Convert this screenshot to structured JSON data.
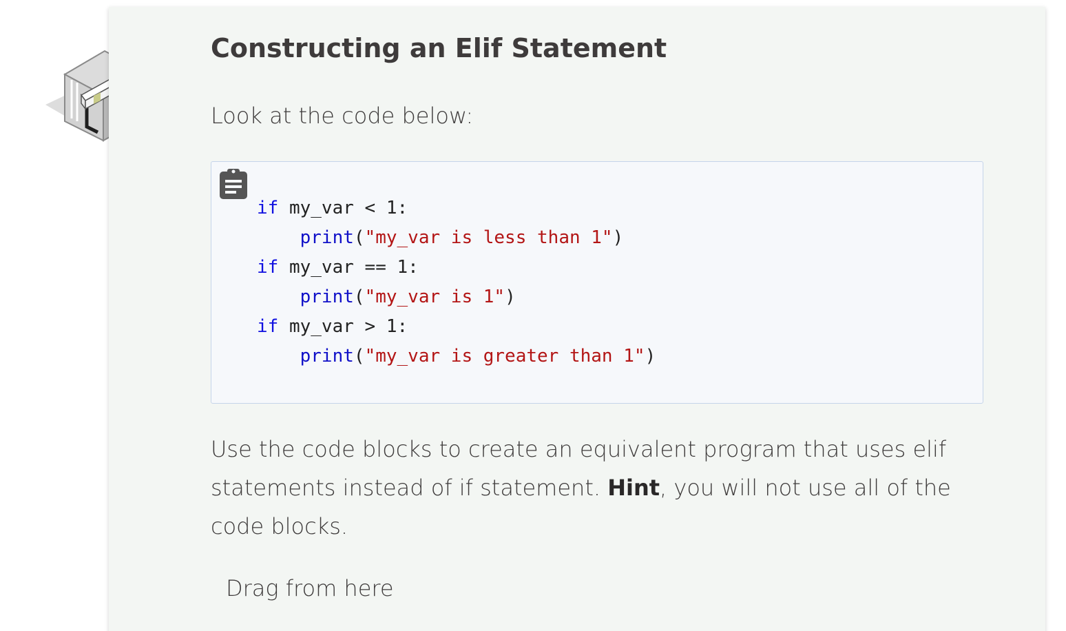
{
  "lesson": {
    "title": "Constructing an Elif Statement",
    "intro": "Look at the code below:",
    "icon": "hurdle-icon",
    "accent_color": "#c9cc8a"
  },
  "code_box": {
    "copy_icon": "clipboard-icon",
    "lines": [
      {
        "keyword": "if",
        "rest": " my_var < 1:"
      },
      {
        "indent": "    ",
        "func": "print",
        "open": "(",
        "string": "\"my_var is less than 1\"",
        "close": ")"
      },
      {
        "keyword": "if",
        "rest": " my_var == 1:"
      },
      {
        "indent": "    ",
        "func": "print",
        "open": "(",
        "string": "\"my_var is 1\"",
        "close": ")"
      },
      {
        "keyword": "if",
        "rest": " my_var > 1:"
      },
      {
        "indent": "    ",
        "func": "print",
        "open": "(",
        "string": "\"my_var is greater than 1\"",
        "close": ")"
      }
    ],
    "colors": {
      "keyword": "#1010e0",
      "string": "#b31515",
      "background": "#f6f8fb",
      "border": "#c5d4ea"
    }
  },
  "instructions": {
    "part1": "Use the code blocks to create an equivalent program that uses elif statements instead of if statement. ",
    "hint_label": "Hint",
    "part2": ", you will not use all of the code blocks."
  },
  "drag_area": {
    "label": "Drag from here"
  }
}
